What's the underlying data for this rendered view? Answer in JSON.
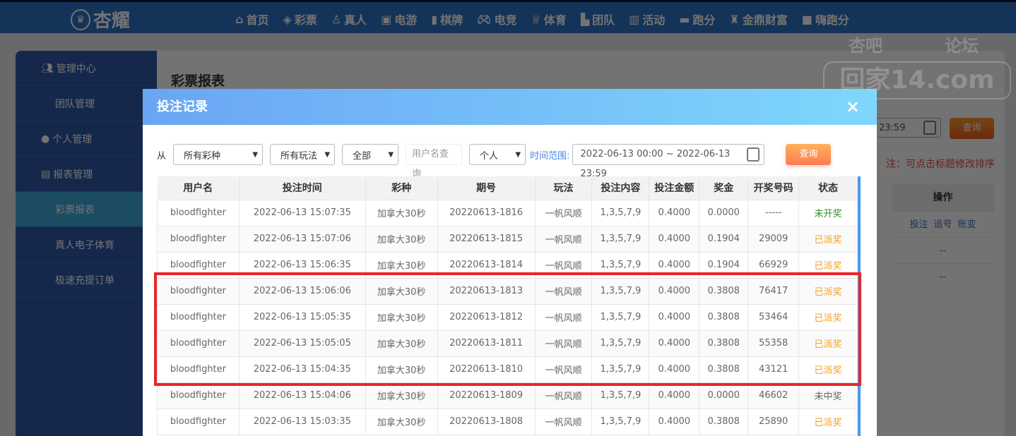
{
  "nav": {
    "logo_text": "杏耀",
    "items": [
      {
        "label": "首页",
        "icon": "home-icon"
      },
      {
        "label": "彩票",
        "icon": "lottery-icon"
      },
      {
        "label": "真人",
        "icon": "live-icon"
      },
      {
        "label": "电游",
        "icon": "slot-icon"
      },
      {
        "label": "棋牌",
        "icon": "card-icon"
      },
      {
        "label": "电竞",
        "icon": "gamepad-icon"
      },
      {
        "label": "体育",
        "icon": "trophy-icon"
      },
      {
        "label": "团队",
        "icon": "team-icon"
      },
      {
        "label": "活动",
        "icon": "gift-icon"
      },
      {
        "label": "跑分",
        "icon": "rhino-icon"
      },
      {
        "label": "金鼎财富",
        "icon": "ding-icon"
      },
      {
        "label": "嗨跑分",
        "icon": "hi-icon"
      }
    ]
  },
  "watermark": {
    "top_left": "杏吧",
    "top_right": "论坛",
    "main": "回家14.com"
  },
  "sidebar": {
    "items": [
      {
        "label": "管理中心",
        "type": "group",
        "icon": "users-icon"
      },
      {
        "label": "团队管理",
        "type": "sub"
      },
      {
        "label": "个人管理",
        "type": "group",
        "icon": "user-icon"
      },
      {
        "label": "报表管理",
        "type": "group",
        "icon": "report-icon"
      },
      {
        "label": "彩票报表",
        "type": "sub",
        "active": true
      },
      {
        "label": "真人电子体育",
        "type": "sub"
      },
      {
        "label": "极速充提订单",
        "type": "sub"
      }
    ]
  },
  "background": {
    "title": "彩票报表",
    "date_tail": "23:59",
    "query": "查询",
    "note": "注：可点击标题修改排序",
    "ops_header": "操作",
    "ops_links": [
      "投注",
      "追号",
      "账变"
    ],
    "empty": [
      "--",
      "--"
    ]
  },
  "modal": {
    "title": "投注记录",
    "close": "×",
    "filters": {
      "from_label": "从",
      "lottery": "所有彩种",
      "play": "所有玩法",
      "status": "全部",
      "username_placeholder": "用户名查询",
      "scope": "个人",
      "time_label": "时间范围:",
      "date_range": "2022-06-13 00:00 ~ 2022-06-13 23:59",
      "query": "查询"
    },
    "columns": [
      "用户名",
      "投注时间",
      "彩种",
      "期号",
      "玩法",
      "投注内容",
      "投注金额",
      "奖金",
      "开奖号码",
      "状态"
    ],
    "rows": [
      [
        "bloodfighter",
        "2022-06-13 15:07:35",
        "加拿大30秒",
        "20220613-1816",
        "一帆风顺",
        "1,3,5,7,9",
        "0.4000",
        "0.0000",
        "-----",
        "未开奖"
      ],
      [
        "bloodfighter",
        "2022-06-13 15:07:06",
        "加拿大30秒",
        "20220613-1815",
        "一帆风顺",
        "1,3,5,7,9",
        "0.4000",
        "0.1904",
        "29009",
        "已派奖"
      ],
      [
        "bloodfighter",
        "2022-06-13 15:06:35",
        "加拿大30秒",
        "20220613-1814",
        "一帆风顺",
        "1,3,5,7,9",
        "0.4000",
        "0.1904",
        "66929",
        "已派奖"
      ],
      [
        "bloodfighter",
        "2022-06-13 15:06:06",
        "加拿大30秒",
        "20220613-1813",
        "一帆风顺",
        "1,3,5,7,9",
        "0.4000",
        "0.3808",
        "76417",
        "已派奖"
      ],
      [
        "bloodfighter",
        "2022-06-13 15:05:35",
        "加拿大30秒",
        "20220613-1812",
        "一帆风顺",
        "1,3,5,7,9",
        "0.4000",
        "0.3808",
        "53464",
        "已派奖"
      ],
      [
        "bloodfighter",
        "2022-06-13 15:05:05",
        "加拿大30秒",
        "20220613-1811",
        "一帆风顺",
        "1,3,5,7,9",
        "0.4000",
        "0.3808",
        "55358",
        "已派奖"
      ],
      [
        "bloodfighter",
        "2022-06-13 15:04:35",
        "加拿大30秒",
        "20220613-1810",
        "一帆风顺",
        "1,3,5,7,9",
        "0.4000",
        "0.3808",
        "43121",
        "已派奖"
      ],
      [
        "bloodfighter",
        "2022-06-13 15:04:06",
        "加拿大30秒",
        "20220613-1809",
        "一帆风顺",
        "1,3,5,7,9",
        "0.4000",
        "0.0000",
        "46602",
        "未中奖"
      ],
      [
        "bloodfighter",
        "2022-06-13 15:03:35",
        "加拿大30秒",
        "20220613-1808",
        "一帆风顺",
        "1,3,5,7,9",
        "0.4000",
        "0.3808",
        "25890",
        "已派奖"
      ]
    ]
  },
  "colors": {
    "highlight": "#e8262a",
    "header_from": "#6aa5f4",
    "header_to": "#7fd7fd"
  }
}
